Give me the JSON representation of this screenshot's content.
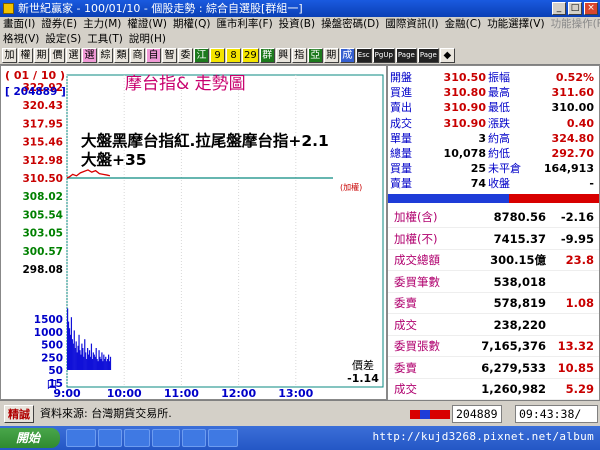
{
  "window": {
    "title": "新世紀贏家 - 100/01/10 - 個股走勢 : 綜合自選股[群組一]",
    "buttons": [
      "_",
      "□",
      "×"
    ]
  },
  "menu": {
    "row1": [
      "畫面(I)",
      "證券(E)",
      "主力(M)",
      "權證(W)",
      "期權(Q)",
      "匯市利率(F)",
      "投資(B)",
      "操盤密碼(D)",
      "國際資訊(I)",
      "金融(C)",
      "功能選擇(V)",
      "功能操作(F)"
    ],
    "row1_disabled": [
      false,
      false,
      false,
      false,
      false,
      false,
      false,
      false,
      false,
      false,
      false,
      true
    ],
    "row2": [
      "格視(V)",
      "設定(S)",
      "工具(T)",
      "說明(H)"
    ]
  },
  "toolbar": {
    "buttons": [
      {
        "label": "加",
        "style": "plain"
      },
      {
        "label": "權",
        "style": "plain"
      },
      {
        "label": "期",
        "style": "plain"
      },
      {
        "label": "價",
        "style": "plain"
      },
      {
        "label": "選",
        "style": "plain"
      },
      {
        "label": "選",
        "style": "pink"
      },
      {
        "label": "綜",
        "style": "plain"
      },
      {
        "label": "類",
        "style": "plain"
      },
      {
        "label": "商",
        "style": "plain"
      },
      {
        "label": "自",
        "style": "pink"
      },
      {
        "label": "智",
        "style": "plain"
      },
      {
        "label": "委",
        "style": "plain"
      },
      {
        "label": "江",
        "style": "green"
      },
      {
        "label": "9",
        "style": "yellow"
      },
      {
        "label": "8",
        "style": "yellow"
      },
      {
        "label": "29",
        "style": "yellow"
      },
      {
        "label": "群",
        "style": "green"
      },
      {
        "label": "興",
        "style": "plain"
      },
      {
        "label": "指",
        "style": "plain"
      },
      {
        "label": "亞",
        "style": "green"
      },
      {
        "label": "期",
        "style": "plain"
      },
      {
        "label": "成",
        "style": "blue"
      },
      {
        "label": "Esc",
        "style": "dark"
      },
      {
        "label": "PgUp",
        "style": "dark"
      },
      {
        "label": "Page",
        "style": "dark"
      },
      {
        "label": "Page",
        "style": "dark"
      },
      {
        "label": "◆",
        "style": "plain"
      }
    ]
  },
  "chart": {
    "rank": "( 01 / 10 )",
    "code": "[ 204889 ]",
    "title": "摩台指&  走勢圖",
    "annotation_line1": "大盤黑摩台指紅.拉尾盤摩台指+2.1",
    "annotation_line2": "大盤+35",
    "ref_label": "(加權)",
    "diff_label": "價差",
    "diff_value": "-1.14",
    "vol_unit": "口"
  },
  "chart_data": {
    "type": "line",
    "price_ticks": [
      "322.92",
      "320.43",
      "317.95",
      "315.46",
      "312.98",
      "310.50",
      "308.02",
      "305.54",
      "303.05",
      "300.57",
      "298.08"
    ],
    "volume_ticks": [
      "1500",
      "1000",
      "500",
      "250",
      "50",
      "15"
    ],
    "x_ticks": [
      "9:00",
      "10:00",
      "11:00",
      "12:00",
      "13:00"
    ],
    "ylim": [
      298.08,
      322.92
    ],
    "reference_price": 310.5,
    "open_minute": 0,
    "close_minute": 300,
    "price_series": {
      "minutes": [
        0,
        3,
        6,
        10,
        14,
        18,
        22,
        26,
        30,
        34,
        38,
        42,
        45
      ],
      "values": [
        310.5,
        310.7,
        311.0,
        310.8,
        311.2,
        311.4,
        311.6,
        311.3,
        311.5,
        311.1,
        311.0,
        310.9,
        310.8
      ]
    },
    "reference_series": {
      "minutes": [
        0,
        45
      ],
      "values": [
        310.5,
        310.5
      ]
    },
    "volume_series": {
      "minutes": [
        0,
        1,
        2,
        3,
        4,
        5,
        6,
        7,
        8,
        9,
        10,
        11,
        12,
        13,
        14,
        15,
        16,
        17,
        18,
        19,
        20,
        21,
        22,
        23,
        24,
        25,
        26,
        27,
        28,
        29,
        30,
        31,
        32,
        33,
        34,
        35,
        36,
        37,
        38,
        39,
        40,
        41,
        42,
        43,
        44,
        45
      ],
      "values": [
        1400,
        1100,
        950,
        800,
        1200,
        700,
        600,
        900,
        500,
        650,
        400,
        550,
        800,
        450,
        350,
        600,
        500,
        300,
        700,
        400,
        250,
        500,
        350,
        450,
        300,
        600,
        250,
        400,
        350,
        300,
        500,
        250,
        200,
        450,
        300,
        250,
        400,
        200,
        350,
        250,
        300,
        200,
        250,
        350,
        200,
        300
      ]
    }
  },
  "panel": {
    "price_rows": [
      {
        "l1": "開盤",
        "v1": "310.50",
        "l2": "振幅",
        "v2": "0.52%",
        "c1": "#c80000",
        "c2": "#c80000"
      },
      {
        "l1": "買進",
        "v1": "310.80",
        "l2": "最高",
        "v2": "311.60",
        "c1": "#c80000",
        "c2": "#c80000"
      },
      {
        "l1": "賣出",
        "v1": "310.90",
        "l2": "最低",
        "v2": "310.00",
        "c1": "#c80000",
        "c2": "#000000"
      },
      {
        "l1": "成交",
        "v1": "310.90",
        "l2": "漲跌",
        "v2": "0.40",
        "c1": "#c80000",
        "c2": "#c80000"
      },
      {
        "l1": "單量",
        "v1": "3",
        "l2": "約高",
        "v2": "324.80",
        "c1": "#000000",
        "c2": "#c80000"
      },
      {
        "l1": "總量",
        "v1": "10,078",
        "l2": "約低",
        "v2": "292.70",
        "c1": "#000000",
        "c2": "#c80000"
      },
      {
        "l1": "買量",
        "v1": "25",
        "l2": "未平倉",
        "v2": "164,913",
        "c1": "#000000",
        "c2": "#000000"
      },
      {
        "l1": "賣量",
        "v1": "74",
        "l2": "收盤",
        "v2": "-",
        "c1": "#000000",
        "c2": "#000000"
      }
    ],
    "index_rows": [
      {
        "label": "加權(含)",
        "value": "8780.56",
        "change": "-2.16",
        "cv": "#000000",
        "cc": "#000000"
      },
      {
        "label": "加權(不)",
        "value": "7415.37",
        "change": "-9.95",
        "cv": "#000000",
        "cc": "#000000"
      },
      {
        "label": "成交總額",
        "value": "300.15億",
        "change": "23.8",
        "cv": "#000000",
        "cc": "#c80000"
      },
      {
        "label": "委買筆數",
        "value": "538,018",
        "change": "",
        "cv": "#000000",
        "cc": "#000000"
      },
      {
        "label": "委賣",
        "value": "578,819",
        "change": "1.08",
        "cv": "#000000",
        "cc": "#c80000"
      },
      {
        "label": "成交",
        "value": "238,220",
        "change": "",
        "cv": "#000000",
        "cc": "#000000"
      },
      {
        "label": "委買張數",
        "value": "7,165,376",
        "change": "13.32",
        "cv": "#000000",
        "cc": "#c80000"
      },
      {
        "label": "委賣",
        "value": "6,279,533",
        "change": "10.85",
        "cv": "#000000",
        "cc": "#c80000"
      },
      {
        "label": "成交",
        "value": "1,260,982",
        "change": "5.29",
        "cv": "#000000",
        "cc": "#c80000"
      }
    ],
    "colors": {
      "up": "#c80000",
      "label": "#0000c8",
      "index_label": "#b0006e"
    }
  },
  "status": {
    "tag": "精誠",
    "source": "資料來源: 台灣期貨交易所.",
    "code": "204889",
    "time": "09:43:38/"
  },
  "taskbar": {
    "start": "開始",
    "url": "http://kujd3268.pixnet.net/album"
  }
}
